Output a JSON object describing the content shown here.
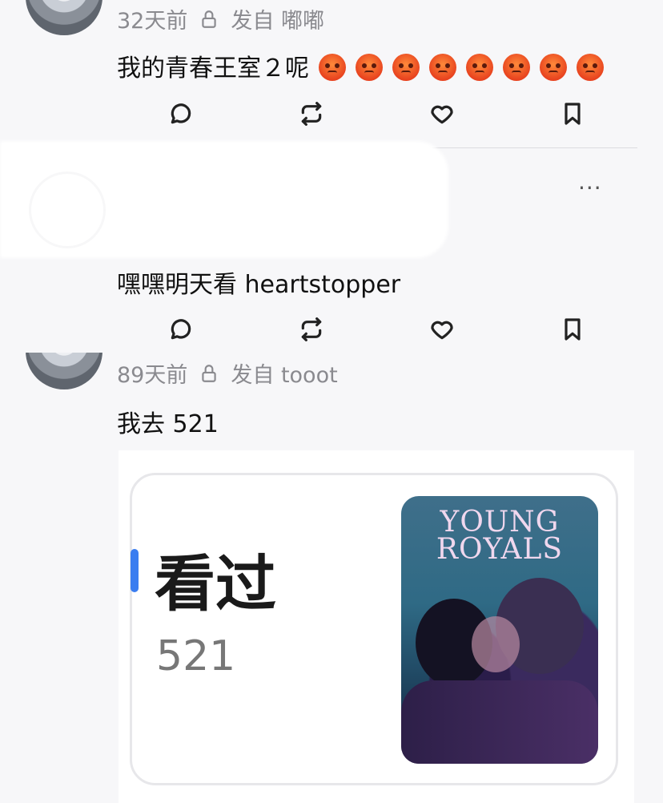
{
  "posts": [
    {
      "time": "32天前",
      "source": "发自 嘟嘟",
      "text": "我的青春王室２呢",
      "emoji_count": 8,
      "emoji": "angry-face-icon"
    },
    {
      "text": "嘿嘿明天看 heartstopper"
    },
    {
      "time": "89天前",
      "source": "发自 tooot",
      "text": "我去 521",
      "attachment": {
        "label": "看过",
        "count": "521",
        "poster_title_line1": "YOUNG",
        "poster_title_line2": "ROYALS"
      }
    }
  ],
  "actions": {
    "more": "···"
  },
  "colors": {
    "accent": "#3a7df0",
    "meta_text": "#8a8a8f"
  }
}
